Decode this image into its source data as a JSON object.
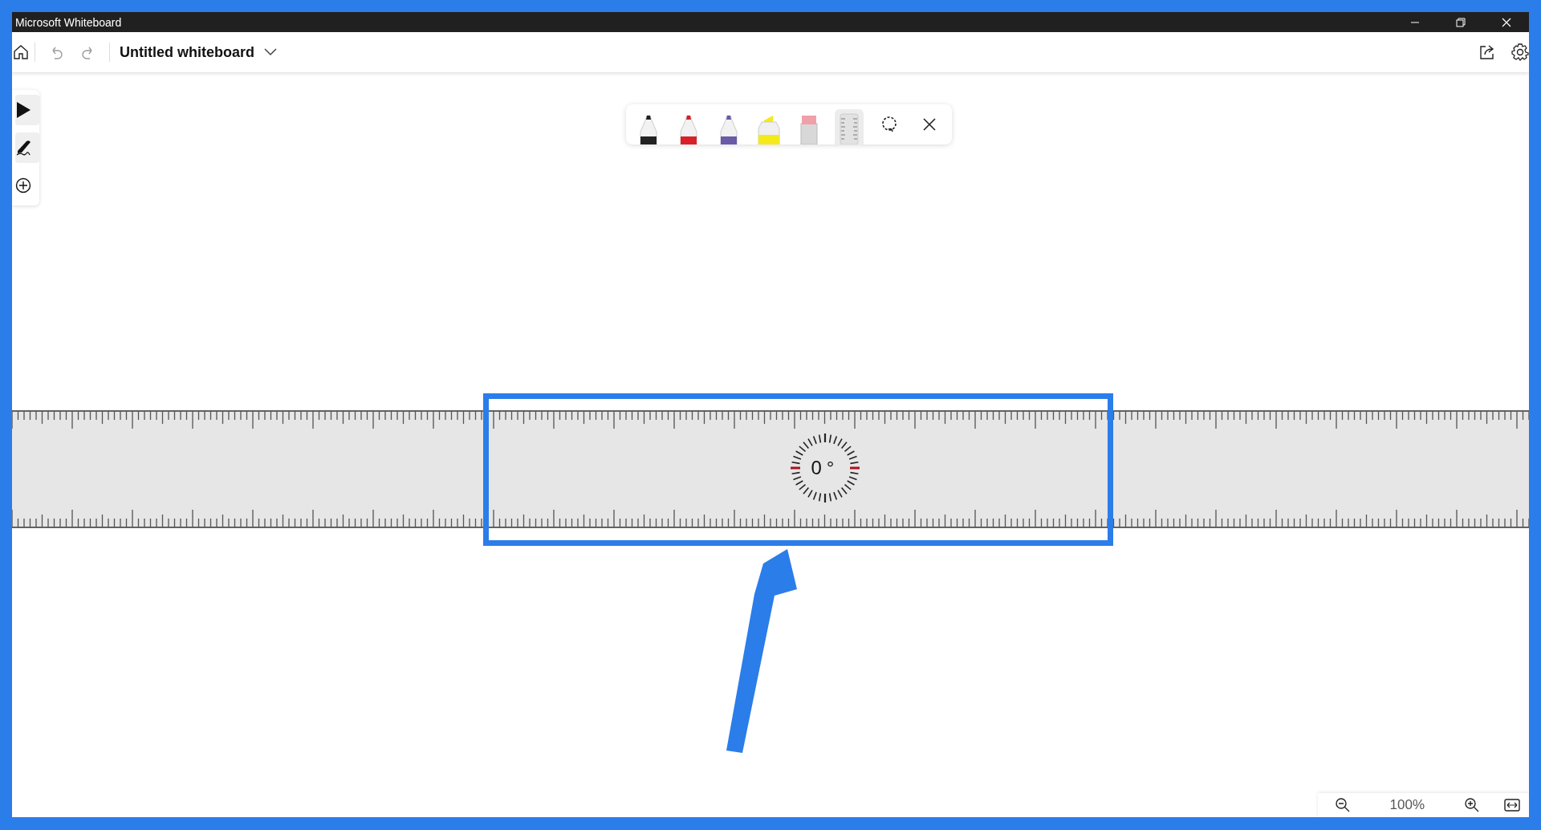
{
  "window": {
    "title": "Microsoft Whiteboard"
  },
  "toolbar": {
    "board_title": "Untitled whiteboard"
  },
  "side_tools": [
    {
      "kind": "select",
      "selected": true
    },
    {
      "kind": "pen",
      "selected": true
    },
    {
      "kind": "add",
      "selected": false
    }
  ],
  "ink_tools": [
    {
      "kind": "pen",
      "color": "#222222",
      "selected": false
    },
    {
      "kind": "pen",
      "color": "#d8202a",
      "selected": false
    },
    {
      "kind": "pen",
      "color": "#6a5aa8",
      "selected": false
    },
    {
      "kind": "highlighter",
      "color": "#f4ea1a",
      "selected": false
    },
    {
      "kind": "eraser",
      "color": "#f0a0a8",
      "selected": false
    },
    {
      "kind": "ruler",
      "selected": true
    },
    {
      "kind": "lasso",
      "selected": false
    },
    {
      "kind": "close",
      "selected": false
    }
  ],
  "ruler": {
    "angle": "0°"
  },
  "zoom": {
    "value": "100%"
  }
}
